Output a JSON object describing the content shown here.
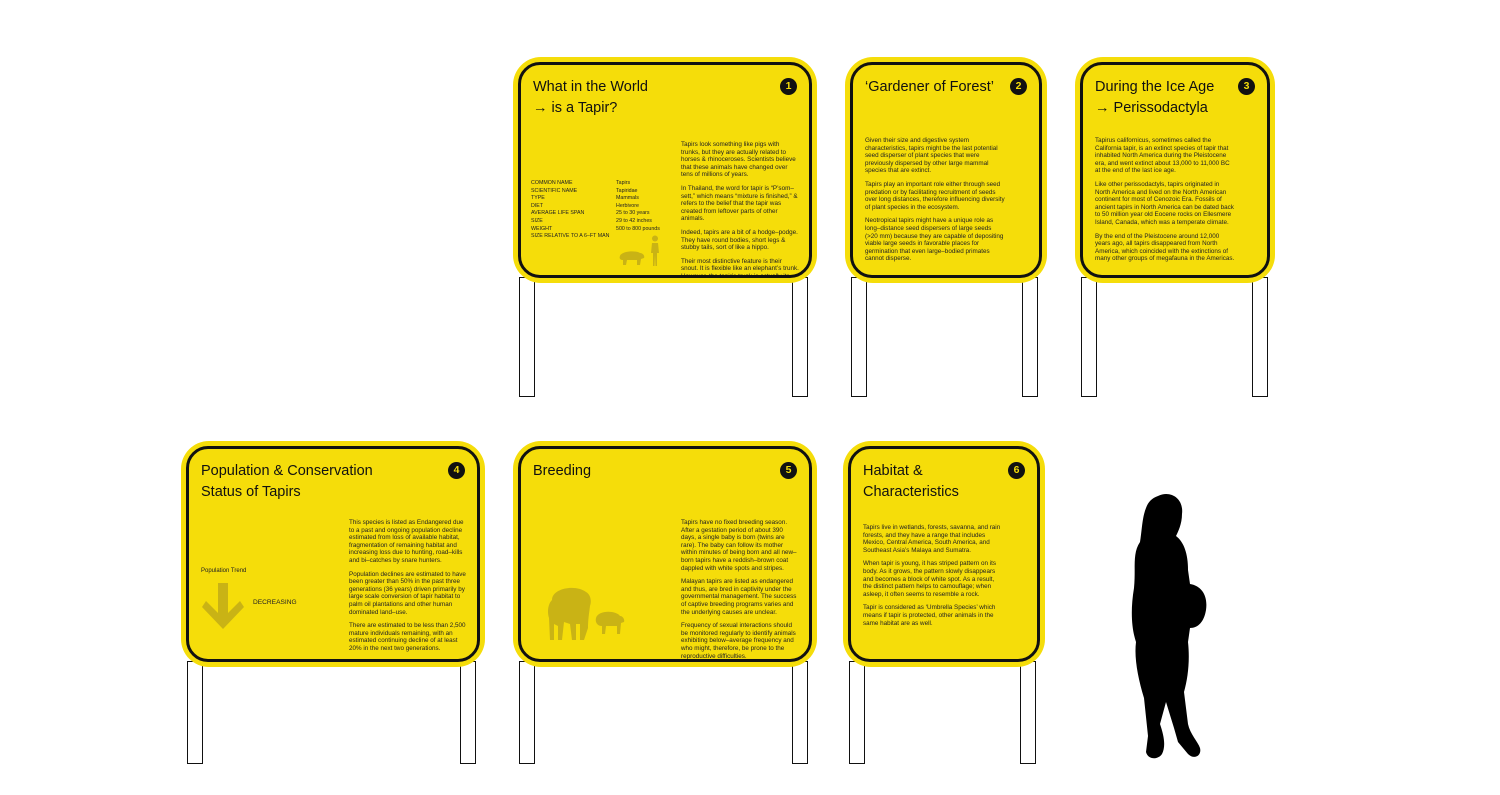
{
  "signs": [
    {
      "title": "What in the World\n→ is a Tapir?",
      "number": "1",
      "paragraphs": [
        "Tapirs look something like pigs with trunks, but they are actually related to horses & rhinoceroses. Scientists believe that these animals have changed over tens of millions of years.",
        "In Thailand, the word for tapir is “P’som–sett,” which means “mixture is finished,” & refers to the belief that the tapir was created from leftover parts of other animals.",
        "Indeed, tapirs are a bit of a hodge–podge. They have round bodies, short legs & stubby tails, sort of like a hippo.",
        "Their most distinctive feature is their snout. It is flexible like an elephant’s trunk. However, the tapir’s trunk is actually its upper lip & nose."
      ],
      "fact_labels": [
        "COMMON NAME",
        "SCIENTIFIC NAME",
        "TYPE",
        "DIET",
        "AVERAGE LIFE SPAN",
        "SIZE",
        "WEIGHT",
        "SIZE RELATIVE TO A 6–FT MAN"
      ],
      "fact_values": [
        "Tapirs",
        "Tapiridae",
        "Mammals",
        "Herbivore",
        "25 to 30 years",
        "29 to 42 inches",
        "500 to 800 pounds"
      ]
    },
    {
      "title": "‘Gardener of Forest’",
      "number": "2",
      "paragraphs": [
        "Given their size and digestive system characteristics, tapirs might be the last potential seed disperser of plant species that were previously dispersed by other large mammal species that are extinct.",
        "Tapirs play an important role either through seed predation or by facilitating recruitment of seeds over long distances, therefore influencing diversity of plant species in the ecosystem.",
        "Neotropical tapirs might have a unique role as long–distance seed dispersers of large seeds (>20 mm) because they are capable of depositing viable large seeds in favorable places for germination that even large–bodied primates cannot disperse."
      ]
    },
    {
      "title": "During the Ice Age\n→ Perissodactyla",
      "number": "3",
      "paragraphs": [
        "Tapirus californicus, sometimes called the California tapir, is an extinct species of tapir that inhabited North America during the Pleistocene era, and went extinct about 13,000 to 11,000 BC at the end of the last ice age.",
        "Like other perissodactyls, tapirs originated in North America and lived on the North American continent for most of Cenozoic Era. Fossils of ancient tapirs in North America can be dated back to 50 million year old Eocene rocks on Ellesmere Island, Canada, which was a temperate climate.",
        "By the end of the Pleistocene around 12,000 years ago, all tapirs disappeared from North America, which coincided with the extinctions of many other groups of megafauna in the Americas."
      ]
    },
    {
      "title": "Population & Conservation\nStatus of Tapirs",
      "number": "4",
      "paragraphs": [
        "This species is listed as Endangered due to a past and ongoing population decline estimated from loss of available habitat, fragmentation of remaining habitat and increasing loss due to hunting, road–kills and bi–catches by snare hunters.",
        "Population declines are estimated to have been greater than 50% in the past three generations (36 years) driven primarily by large scale conversion of tapir habitat to palm oil plantations and other human dominated land–use.",
        "There are estimated to be less than 2,500 mature individuals remaining, with an estimated continuing decline of at least 20% in the next two generations."
      ],
      "trend_label": "Population Trend",
      "trend_value": "DECREASING"
    },
    {
      "title": "Breeding",
      "number": "5",
      "paragraphs": [
        "Tapirs have no fixed breeding season. After a gestation period of about 390 days, a single baby is born (twins are rare). The baby can follow its mother within minutes of being born and all new–born tapirs have a reddish–brown coat dappled with white spots and stripes.",
        "Malayan tapirs are listed as endangered and thus, are bred in captivity under the governmental management. The success of captive breeding programs varies and the underlying causes are unclear.",
        "Frequency of sexual interactions should be monitored regularly to identify animals exhibiting below–average frequency and who might, therefore, be prone to the reproductive difficulties."
      ]
    },
    {
      "title": "Habitat &\nCharacteristics",
      "number": "6",
      "paragraphs": [
        "Tapirs live in wetlands, forests, savanna, and rain forests, and they have a range that includes Mexico, Central America, South America, and Southeast Asia’s Malaya and Sumatra.",
        "When tapir is young, it has striped pattern on its body. As it grows, the pattern slowly disappears and becomes a block of white spot. As a result, the distinct pattern helps to camouflage; when asleep, it often seems to resemble a rock.",
        "Tapir is considered as ‘Umbrella Species’ which means if tapir is protected, other animals in the same habitat are as well."
      ]
    }
  ],
  "colors": {
    "board": "#f5dd0a",
    "ink": "#111111",
    "muted": "#c9b315"
  },
  "icons": [
    "tapir-silhouette-icon",
    "man-silhouette-icon",
    "down-arrow-icon",
    "tapir-mother-calf-icon",
    "person-silhouette"
  ]
}
